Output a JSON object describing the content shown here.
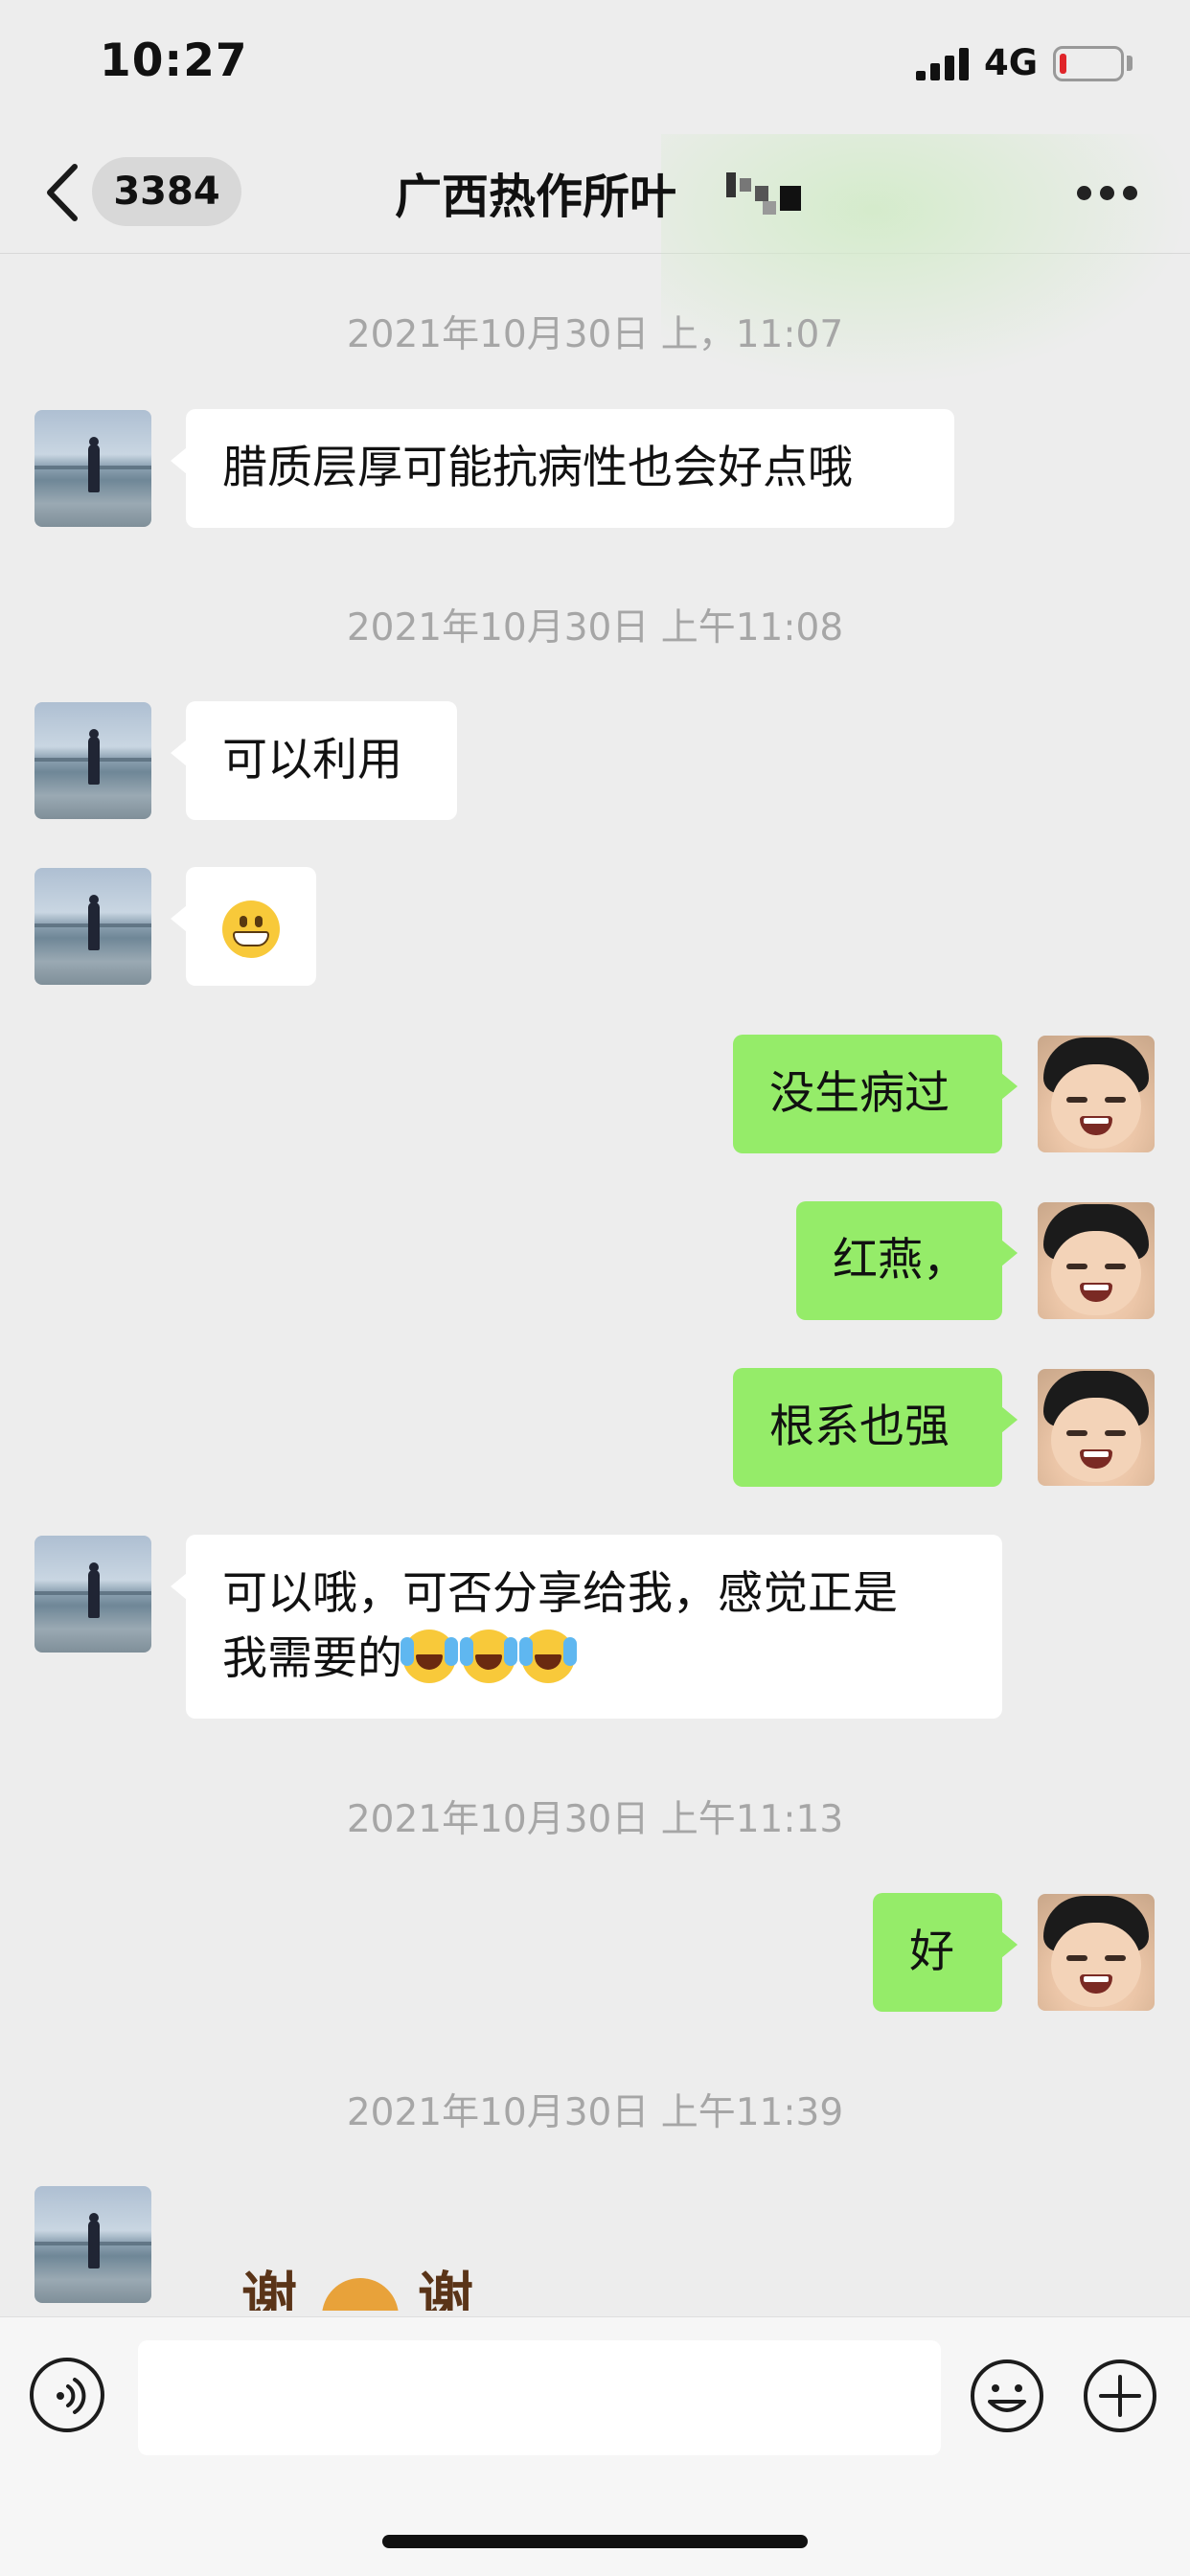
{
  "status_bar": {
    "time": "10:27",
    "network": "4G"
  },
  "nav": {
    "unread_count": "3384",
    "title": "广西热作所叶"
  },
  "messages": [
    {
      "type": "timestamp",
      "text": "2021年10月30日 上，11:07"
    },
    {
      "type": "incoming",
      "text": "腊质层厚可能抗病性也会好点哦"
    },
    {
      "type": "timestamp",
      "text": "2021年10月30日 上午11:08"
    },
    {
      "type": "incoming",
      "text": "可以利用"
    },
    {
      "type": "incoming_emoji",
      "emoji": "grinning-face-emoji"
    },
    {
      "type": "outgoing",
      "text": "没生病过"
    },
    {
      "type": "outgoing",
      "text": "红燕，"
    },
    {
      "type": "outgoing",
      "text": "根系也强"
    },
    {
      "type": "incoming",
      "line1": "可以哦，可否分享给我，感觉正是",
      "line2": "我需要的",
      "emojis": [
        "crying-laughing-emoji",
        "crying-laughing-emoji",
        "crying-laughing-emoji"
      ]
    },
    {
      "type": "timestamp",
      "text": "2021年10月30日 上午11:13"
    },
    {
      "type": "outgoing",
      "text": "好"
    },
    {
      "type": "timestamp",
      "text": "2021年10月30日 上午11:39"
    },
    {
      "type": "incoming_sticker",
      "left_char": "谢",
      "right_char": "谢"
    }
  ],
  "colors": {
    "outgoing_bubble": "#95ec69",
    "incoming_bubble": "#ffffff",
    "background": "#ededed",
    "battery_low": "#e0252a"
  },
  "icons": [
    "back-arrow-icon",
    "more-options-icon",
    "voice-icon",
    "emoji-icon",
    "add-icon",
    "signal-icon",
    "battery-icon"
  ]
}
